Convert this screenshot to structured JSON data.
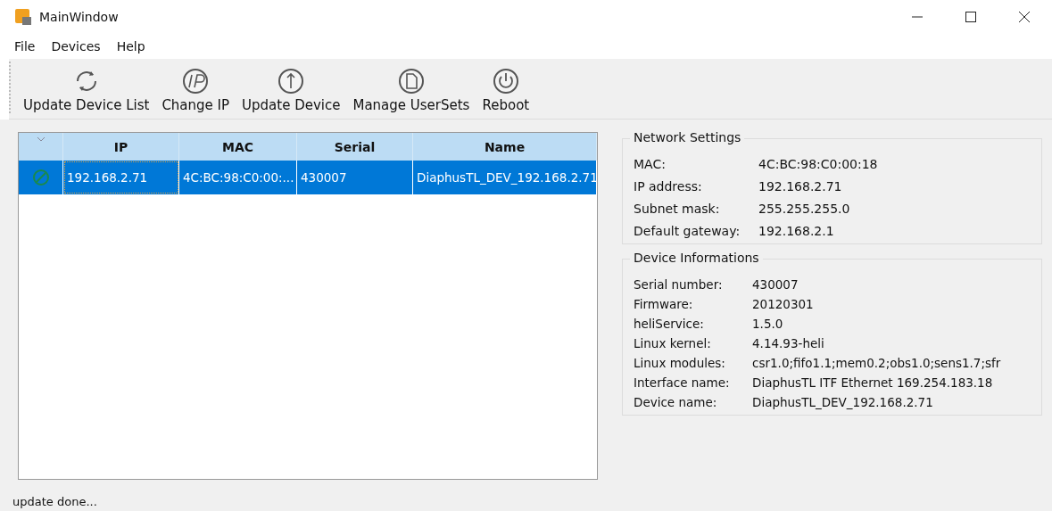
{
  "window": {
    "title": "MainWindow"
  },
  "menu": [
    "File",
    "Devices",
    "Help"
  ],
  "toolbar": [
    {
      "label": "Update Device List",
      "kind": "refresh"
    },
    {
      "label": "Change IP",
      "kind": "ip"
    },
    {
      "label": "Update Device",
      "kind": "upload"
    },
    {
      "label": "Manage UserSets",
      "kind": "file"
    },
    {
      "label": "Reboot",
      "kind": "power"
    }
  ],
  "table": {
    "columns": [
      "IP",
      "MAC",
      "Serial",
      "Name"
    ],
    "rows": [
      {
        "selected": true,
        "cells": [
          "192.168.2.71",
          "4C:BC:98:C0:00:...",
          "430007",
          "DiaphusTL_DEV_192.168.2.71"
        ]
      }
    ]
  },
  "panels": [
    {
      "title": "Network Settings",
      "fields": [
        {
          "label": "MAC:",
          "value": "4C:BC:98:C0:00:18"
        },
        {
          "label": "IP address:",
          "value": "192.168.2.71"
        },
        {
          "label": "Subnet mask:",
          "value": "255.255.255.0"
        },
        {
          "label": "Default gateway:",
          "value": "192.168.2.1"
        }
      ]
    },
    {
      "title": "Device Informations",
      "fields": [
        {
          "label": "Serial number:",
          "value": "430007"
        },
        {
          "label": "Firmware:",
          "value": "20120301"
        },
        {
          "label": "heliService:",
          "value": "1.5.0"
        },
        {
          "label": "Linux kernel:",
          "value": "4.14.93-heli"
        },
        {
          "label": "Linux modules:",
          "value": "csr1.0;fifo1.1;mem0.2;obs1.0;sens1.7;sfr"
        },
        {
          "label": "Interface name:",
          "value": "DiaphusTL ITF Ethernet 169.254.183.18"
        },
        {
          "label": "Device name:",
          "value": "DiaphusTL_DEV_192.168.2.71"
        }
      ]
    }
  ],
  "status_bar": "update done..."
}
